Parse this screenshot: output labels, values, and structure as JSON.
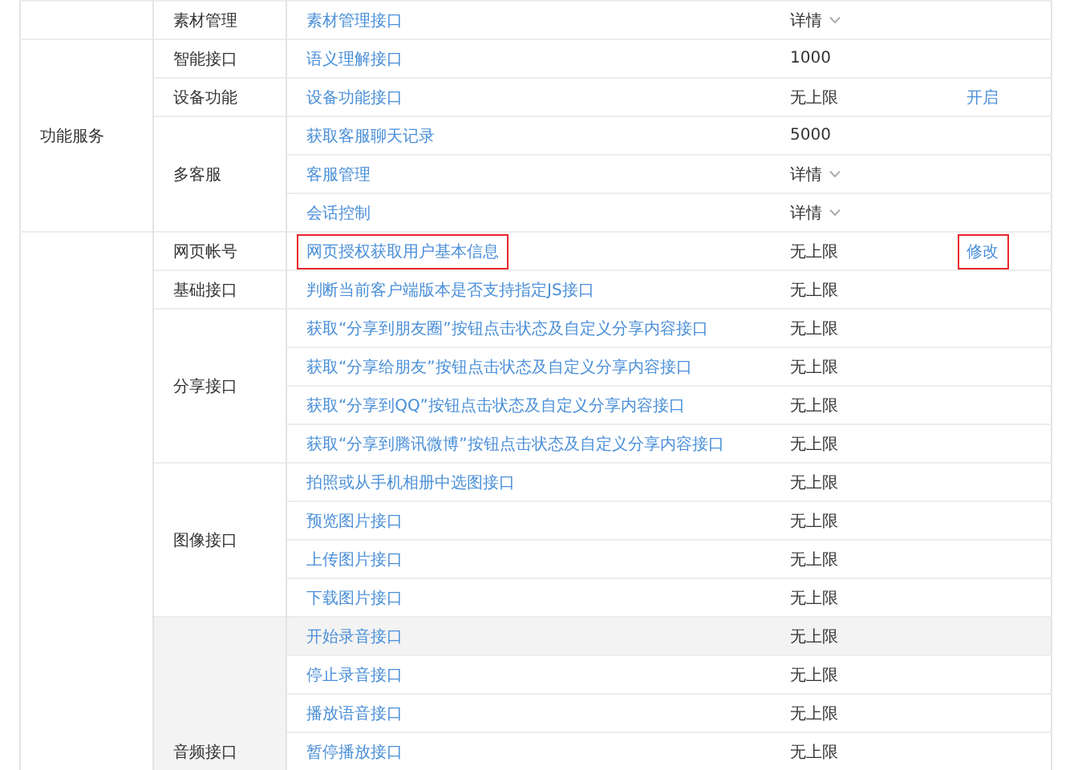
{
  "groups": [
    {
      "subgroups": [
        {
          "label": "素材管理",
          "rows": [
            {
              "name": "素材管理接口",
              "limit": "详情",
              "kind": "dropdown",
              "highlighted": false,
              "annotated": false
            }
          ]
        }
      ]
    },
    {
      "label": "功能服务",
      "subgroups": [
        {
          "label": "智能接口",
          "rows": [
            {
              "name": "语义理解接口",
              "limit": "1000",
              "kind": "text",
              "highlighted": false,
              "annotated": false
            }
          ]
        },
        {
          "label": "设备功能",
          "rows": [
            {
              "name": "设备功能接口",
              "limit": "无上限",
              "kind": "text",
              "action": "开启",
              "highlighted": false,
              "annotated": false
            }
          ]
        },
        {
          "label": "多客服",
          "rows": [
            {
              "name": "获取客服聊天记录",
              "limit": "5000",
              "kind": "text",
              "highlighted": false,
              "annotated": false
            },
            {
              "name": "客服管理",
              "limit": "详情",
              "kind": "dropdown",
              "highlighted": false,
              "annotated": false
            },
            {
              "name": "会话控制",
              "limit": "详情",
              "kind": "dropdown",
              "highlighted": false,
              "annotated": false
            }
          ]
        }
      ]
    },
    {
      "subgroups": [
        {
          "label": "网页帐号",
          "rows": [
            {
              "name": "网页授权获取用户基本信息",
              "limit": "无上限",
              "kind": "text",
              "action": "修改",
              "highlighted": false,
              "annotated": true
            }
          ]
        },
        {
          "label": "基础接口",
          "rows": [
            {
              "name": "判断当前客户端版本是否支持指定JS接口",
              "limit": "无上限",
              "kind": "text",
              "highlighted": false,
              "annotated": false
            }
          ]
        },
        {
          "label": "分享接口",
          "rows": [
            {
              "name": "获取“分享到朋友圈”按钮点击状态及自定义分享内容接口",
              "limit": "无上限",
              "kind": "text",
              "highlighted": false,
              "annotated": false
            },
            {
              "name": "获取“分享给朋友”按钮点击状态及自定义分享内容接口",
              "limit": "无上限",
              "kind": "text",
              "highlighted": false,
              "annotated": false
            },
            {
              "name": "获取“分享到QQ”按钮点击状态及自定义分享内容接口",
              "limit": "无上限",
              "kind": "text",
              "highlighted": false,
              "annotated": false
            },
            {
              "name": "获取“分享到腾讯微博”按钮点击状态及自定义分享内容接口",
              "limit": "无上限",
              "kind": "text",
              "highlighted": false,
              "annotated": false
            }
          ]
        },
        {
          "label": "图像接口",
          "rows": [
            {
              "name": "拍照或从手机相册中选图接口",
              "limit": "无上限",
              "kind": "text",
              "highlighted": false,
              "annotated": false
            },
            {
              "name": "预览图片接口",
              "limit": "无上限",
              "kind": "text",
              "highlighted": false,
              "annotated": false
            },
            {
              "name": "上传图片接口",
              "limit": "无上限",
              "kind": "text",
              "highlighted": false,
              "annotated": false
            },
            {
              "name": "下载图片接口",
              "limit": "无上限",
              "kind": "text",
              "highlighted": false,
              "annotated": false
            }
          ]
        },
        {
          "label": "音频接口",
          "rows": [
            {
              "name": "开始录音接口",
              "limit": "无上限",
              "kind": "text",
              "highlighted": true,
              "annotated": false
            },
            {
              "name": "停止录音接口",
              "limit": "无上限",
              "kind": "text",
              "highlighted": false,
              "annotated": false
            },
            {
              "name": "播放语音接口",
              "limit": "无上限",
              "kind": "text",
              "highlighted": false,
              "annotated": false
            },
            {
              "name": "暂停播放接口",
              "limit": "无上限",
              "kind": "text",
              "highlighted": false,
              "annotated": false
            }
          ]
        }
      ]
    }
  ]
}
